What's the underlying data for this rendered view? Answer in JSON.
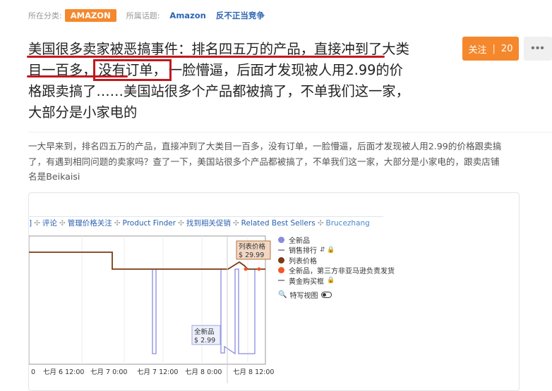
{
  "meta": {
    "category_label": "所在分类:",
    "category_tag": "AMAZON",
    "topic_label": "所属话题:",
    "topics": [
      "Amazon",
      "反不正当竞争"
    ]
  },
  "question": {
    "title_a": "美国很多卖家被恶搞事件：排名四五万的产品，直接冲到了大类目一百多，",
    "title_box": "没有订单，",
    "title_b": "一脸懵逼，后面才发现被人用2.99的价格跟卖搞了……美国站很多个产品都被搞了，不单我们这一家，大部分是小家电的",
    "follow_label": "关注",
    "follow_count": "20",
    "more_label": "•••",
    "body": "一大早来到，排名四五万的产品，直接冲到了大类目一百多，没有订单，一脸懵逼，后面才发现被人用2.99的价格跟卖搞\n了，有遇到相同问题的卖家吗？查了一下，美国站很多个产品都被搞了，不单我们这一家，大部分是小家电的，跟卖店铺\n名是Beikaisi"
  },
  "screenshot": {
    "tabs": [
      "]",
      "评论",
      "管理价格关注",
      "Product Finder",
      "找到相关促销",
      "Related Best Sellers",
      "Brucezhang"
    ],
    "legend": [
      {
        "label": "全新品",
        "kind": "dot",
        "color": "#8a8ae0"
      },
      {
        "label": "销售排行",
        "kind": "dash",
        "icons": "↓⃞ 🔒"
      },
      {
        "label": "列表价格",
        "kind": "dot",
        "color": "#7b3a12"
      },
      {
        "label": "全新品，第三方非亚马逊负责发货",
        "kind": "dot",
        "color": "#f2582a"
      },
      {
        "label": "黄金购买框",
        "kind": "dash",
        "icons": "🔒"
      }
    ],
    "zoom_label": "特写视图",
    "tooltips": {
      "list_price": {
        "title": "列表价格",
        "value": "$ 29.99"
      },
      "new_price": {
        "title": "全新品",
        "value": "$ 2.99"
      }
    },
    "x_ticks": [
      "0",
      "七月 6 12:00",
      "七月 7 0:00",
      "七月 7 12:00",
      "七月 8 0:00",
      "七月 8 12:00"
    ],
    "colors": {
      "list_price": "#7b3a12",
      "new": "#8a8ae0",
      "third_party": "#f2582a"
    }
  },
  "chart_data": {
    "type": "line",
    "x": [
      "七月 6 12:00",
      "七月 7 0:00",
      "七月 7 12:00",
      "七月 8 0:00",
      "七月 8 12:00"
    ],
    "series": [
      {
        "name": "列表价格"
      },
      {
        "name": "全新品"
      }
    ],
    "annotations": [
      "列表价格 $ 29.99",
      "全新品 $ 2.99"
    ]
  }
}
